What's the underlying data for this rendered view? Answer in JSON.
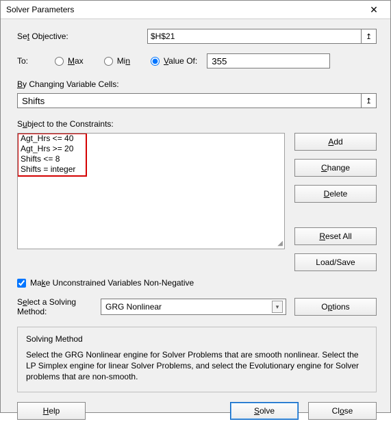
{
  "window": {
    "title": "Solver Parameters",
    "close_glyph": "✕"
  },
  "objective": {
    "label": "Set Objective:",
    "value": "$H$21",
    "picker_glyph": "↥"
  },
  "to": {
    "label": "To:",
    "max_label": "Max",
    "min_label": "Min",
    "valueof_label": "Value Of:",
    "value": "355"
  },
  "cells": {
    "label": "By Changing Variable Cells:",
    "value": "Shifts",
    "picker_glyph": "↥"
  },
  "constraints": {
    "label": "Subject to the Constraints:",
    "items": [
      "Agt_Hrs <= 40",
      "Agt_Hrs >= 20",
      "Shifts <= 8",
      "Shifts = integer"
    ]
  },
  "buttons": {
    "add": "Add",
    "change": "Change",
    "delete": "Delete",
    "reset_all": "Reset All",
    "load_save": "Load/Save",
    "options": "Options",
    "help": "Help",
    "solve": "Solve",
    "close": "Close"
  },
  "nonneg": {
    "label": "Make Unconstrained Variables Non-Negative"
  },
  "method": {
    "label": "Select a Solving Method:",
    "value": "GRG Nonlinear",
    "arrow": "▾"
  },
  "desc": {
    "legend": "Solving Method",
    "text": "Select the GRG Nonlinear engine for Solver Problems that are smooth nonlinear. Select the LP Simplex engine for linear Solver Problems, and select the Evolutionary engine for Solver problems that are non-smooth."
  }
}
